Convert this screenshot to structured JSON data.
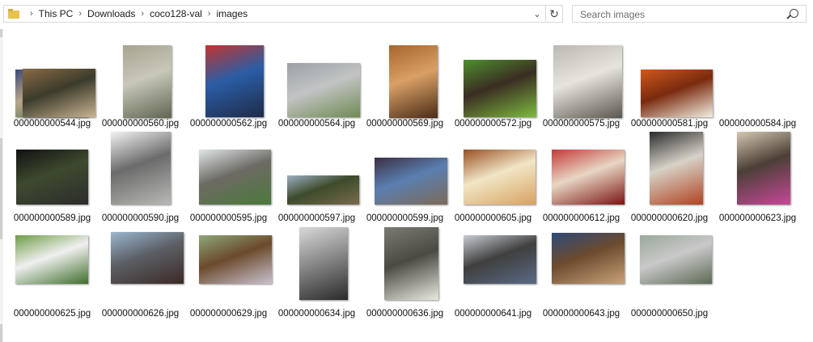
{
  "breadcrumb": [
    "This PC",
    "Downloads",
    "coco128-val",
    "images"
  ],
  "search": {
    "placeholder": "Search images"
  },
  "files": [
    {
      "name": "000000000544.jpg",
      "colors": [
        "#3f4a7a",
        "#2e6b3f",
        "#b9a68a"
      ]
    },
    {
      "name": "000000000560.jpg",
      "colors": [
        "#8a6b45",
        "#c9b490",
        "#3c3b2c"
      ]
    },
    {
      "name": "000000000562.jpg",
      "colors": [
        "#a7a38f",
        "#5f6650",
        "#c8c7b9"
      ]
    },
    {
      "name": "000000000564.jpg",
      "colors": [
        "#c0352e",
        "#1f2b48",
        "#2a5da6"
      ]
    },
    {
      "name": "000000000569.jpg",
      "colors": [
        "#9aa0a6",
        "#6f8a54",
        "#c2c4c4"
      ]
    },
    {
      "name": "000000000572.jpg",
      "colors": [
        "#a7652c",
        "#4a2c18",
        "#d9a065"
      ]
    },
    {
      "name": "000000000575.jpg",
      "colors": [
        "#4f8f2f",
        "#7dba3f",
        "#3a2d22"
      ]
    },
    {
      "name": "000000000581.jpg",
      "colors": [
        "#bbb8b1",
        "#5b5650",
        "#e7e4dd"
      ]
    },
    {
      "name": "000000000584.jpg",
      "colors": [
        "#d05a1b",
        "#f4efe2",
        "#7a2a0e"
      ]
    },
    {
      "name": "000000000589.jpg",
      "colors": [
        "#111111",
        "#2c2c2c",
        "#3d4a2e"
      ]
    },
    {
      "name": "000000000590.jpg",
      "colors": [
        "#f2f2f2",
        "#b9b9b5",
        "#6b6b6b"
      ]
    },
    {
      "name": "000000000595.jpg",
      "colors": [
        "#dfe6ea",
        "#4a7a3a",
        "#6d6a63"
      ]
    },
    {
      "name": "000000000597.jpg",
      "colors": [
        "#9fb0c2",
        "#7b6a4e",
        "#3d4b2b"
      ]
    },
    {
      "name": "000000000599.jpg",
      "colors": [
        "#3c2e42",
        "#7d6a58",
        "#5a7fb0"
      ]
    },
    {
      "name": "000000000605.jpg",
      "colors": [
        "#9a4f22",
        "#d8a260",
        "#f1e6c6"
      ]
    },
    {
      "name": "000000000612.jpg",
      "colors": [
        "#c43a3a",
        "#7a1414",
        "#e8d6c2"
      ]
    },
    {
      "name": "000000000620.jpg",
      "colors": [
        "#2b2b2b",
        "#b04420",
        "#d7d2c8"
      ]
    },
    {
      "name": "000000000623.jpg",
      "colors": [
        "#d6c7b3",
        "#c8479a",
        "#4b4036"
      ]
    },
    {
      "name": "000000000625.jpg",
      "colors": [
        "#6e9c46",
        "#3f6e2b",
        "#f0f0f0"
      ]
    },
    {
      "name": "000000000626.jpg",
      "colors": [
        "#9bb7cf",
        "#3b2a25",
        "#5c5f66"
      ]
    },
    {
      "name": "000000000629.jpg",
      "colors": [
        "#8ea67a",
        "#c9c2cf",
        "#6b4a2c"
      ]
    },
    {
      "name": "000000000634.jpg",
      "colors": [
        "#d9d9d9",
        "#2a2a2a",
        "#8a8a8a"
      ]
    },
    {
      "name": "000000000636.jpg",
      "colors": [
        "#7b7b73",
        "#e9e9df",
        "#4a4a42"
      ]
    },
    {
      "name": "000000000641.jpg",
      "colors": [
        "#c8ccd2",
        "#5a6a85",
        "#3f3f3f"
      ]
    },
    {
      "name": "000000000643.jpg",
      "colors": [
        "#2e4a78",
        "#c9a27a",
        "#6d4b2e"
      ]
    },
    {
      "name": "000000000650.jpg",
      "colors": [
        "#9aa89a",
        "#5c6a54",
        "#c9c9c9"
      ]
    }
  ]
}
